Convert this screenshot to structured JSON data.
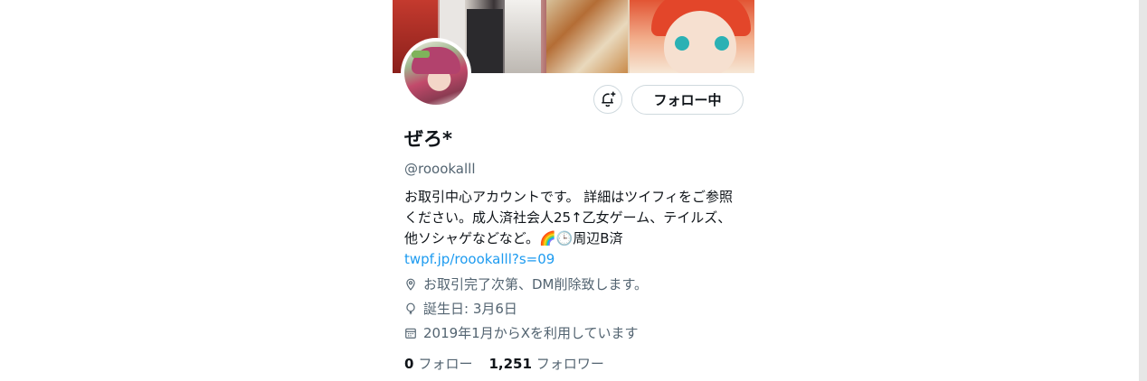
{
  "profile": {
    "display_name": "ぜろ*",
    "handle": "@roookalll",
    "bio_text": "お取引中心アカウントです。 詳細はツイフィをご参照ください。成人済社会人25↑乙女ゲーム、テイルズ、他ソシャゲなどなど。🌈🕒周辺B済 ",
    "bio_link": "twpf.jp/roookalll?s=09",
    "location": "お取引完了次第、DM削除致します。",
    "birthday": "誕生日: 3月6日",
    "joined": "2019年1月からXを利用しています",
    "following_count": "0",
    "following_label": "フォロー",
    "followers_count": "1,251",
    "followers_label": "フォロワー"
  },
  "actions": {
    "follow_label": "フォロー中"
  },
  "icons": {
    "notify": "bell-plus-icon",
    "location": "location-pin-icon",
    "birthday": "balloon-icon",
    "joined": "calendar-icon"
  },
  "colors": {
    "link": "#1d9bf0",
    "muted": "#536471",
    "text": "#0f1419",
    "border": "#cfd9de"
  }
}
